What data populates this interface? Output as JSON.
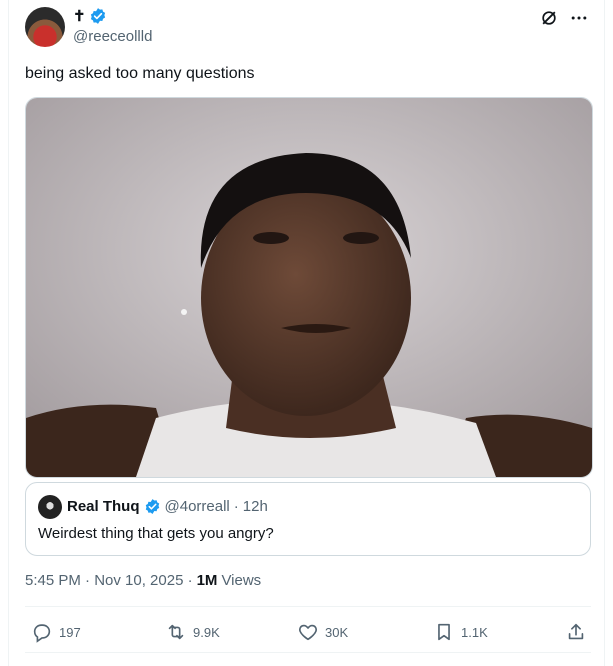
{
  "author": {
    "display_name": "✝",
    "handle": "@reeceollld",
    "verified": true
  },
  "top_actions": {
    "grok_icon": "grok-icon",
    "more_icon": "more-icon"
  },
  "tweet": {
    "text": "being asked too many questions",
    "timestamp": "5:45 PM · Nov 10, 2025 ·",
    "views_count": "1M",
    "views_label": "Views"
  },
  "quoted_tweet": {
    "display_name": "Real Thuq",
    "handle": "@4orreall",
    "separator": "·",
    "time": "12h",
    "text": "Weirdest thing that gets you angry?"
  },
  "engagement": {
    "replies": "197",
    "reposts": "9.9K",
    "likes": "30K",
    "bookmarks": "1.1K"
  },
  "colors": {
    "verified": "#1d9bf0",
    "muted_text": "#536471",
    "border": "#cfd9de"
  }
}
